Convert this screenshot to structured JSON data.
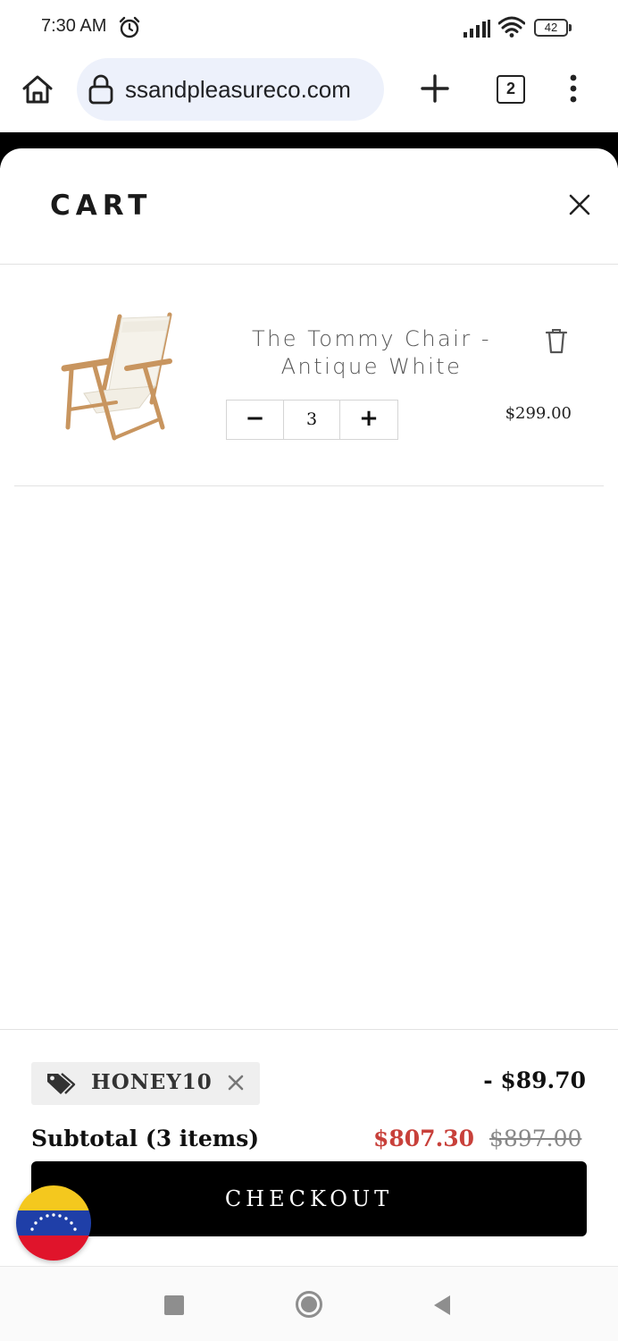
{
  "status_bar": {
    "time": "7:30 AM",
    "battery": "42"
  },
  "browser": {
    "url": "ssandpleasureco.com",
    "tab_count": "2"
  },
  "cart": {
    "title": "CART",
    "items": [
      {
        "name": "The Tommy Chair - Antique White",
        "quantity": "3",
        "price": "$299.00",
        "minus_label": "−",
        "plus_label": "+"
      }
    ]
  },
  "footer": {
    "discount_code": "HONEY10",
    "discount_amount": "- $89.70",
    "subtotal_label": "Subtotal (3 items)",
    "subtotal_new": "$807.30",
    "subtotal_old": "$897.00",
    "checkout_label": "CHECKOUT"
  },
  "icons": {
    "status": [
      "alarm-icon",
      "signal-icon",
      "wifi-icon",
      "battery-icon"
    ],
    "browser": [
      "home-icon",
      "lock-icon",
      "plus-icon",
      "tabs-icon",
      "more-vert-icon"
    ],
    "cart": [
      "close-icon",
      "trash-icon",
      "tag-icon",
      "remove-icon",
      "venezuela-flag-icon"
    ],
    "nav": [
      "recents-icon",
      "home-circle-icon",
      "back-icon"
    ]
  },
  "colors": {
    "accent_sale": "#c8403a",
    "checkout_bg": "#000000",
    "url_pill": "#edf1fb"
  }
}
